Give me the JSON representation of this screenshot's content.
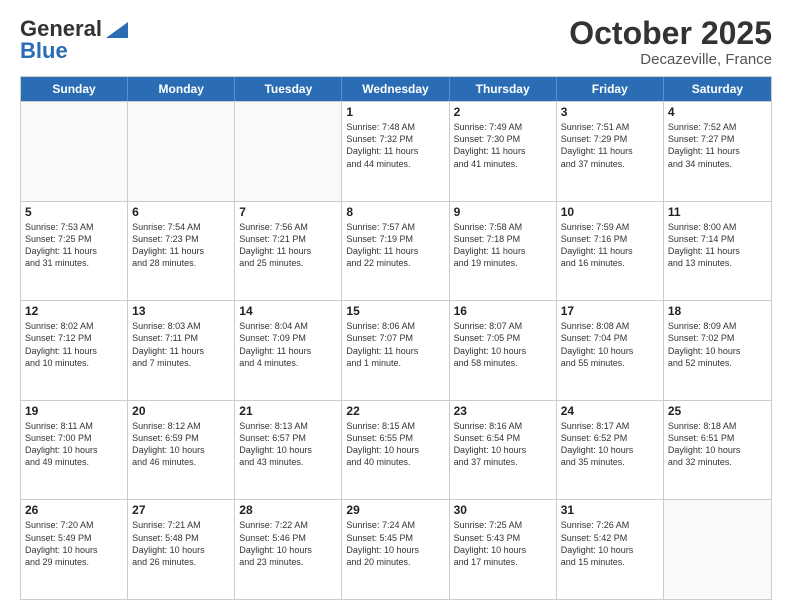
{
  "header": {
    "logo_line1": "General",
    "logo_line2": "Blue",
    "month": "October 2025",
    "location": "Decazeville, France"
  },
  "weekdays": [
    "Sunday",
    "Monday",
    "Tuesday",
    "Wednesday",
    "Thursday",
    "Friday",
    "Saturday"
  ],
  "weeks": [
    [
      {
        "day": "",
        "info": ""
      },
      {
        "day": "",
        "info": ""
      },
      {
        "day": "",
        "info": ""
      },
      {
        "day": "1",
        "info": "Sunrise: 7:48 AM\nSunset: 7:32 PM\nDaylight: 11 hours\nand 44 minutes."
      },
      {
        "day": "2",
        "info": "Sunrise: 7:49 AM\nSunset: 7:30 PM\nDaylight: 11 hours\nand 41 minutes."
      },
      {
        "day": "3",
        "info": "Sunrise: 7:51 AM\nSunset: 7:29 PM\nDaylight: 11 hours\nand 37 minutes."
      },
      {
        "day": "4",
        "info": "Sunrise: 7:52 AM\nSunset: 7:27 PM\nDaylight: 11 hours\nand 34 minutes."
      }
    ],
    [
      {
        "day": "5",
        "info": "Sunrise: 7:53 AM\nSunset: 7:25 PM\nDaylight: 11 hours\nand 31 minutes."
      },
      {
        "day": "6",
        "info": "Sunrise: 7:54 AM\nSunset: 7:23 PM\nDaylight: 11 hours\nand 28 minutes."
      },
      {
        "day": "7",
        "info": "Sunrise: 7:56 AM\nSunset: 7:21 PM\nDaylight: 11 hours\nand 25 minutes."
      },
      {
        "day": "8",
        "info": "Sunrise: 7:57 AM\nSunset: 7:19 PM\nDaylight: 11 hours\nand 22 minutes."
      },
      {
        "day": "9",
        "info": "Sunrise: 7:58 AM\nSunset: 7:18 PM\nDaylight: 11 hours\nand 19 minutes."
      },
      {
        "day": "10",
        "info": "Sunrise: 7:59 AM\nSunset: 7:16 PM\nDaylight: 11 hours\nand 16 minutes."
      },
      {
        "day": "11",
        "info": "Sunrise: 8:00 AM\nSunset: 7:14 PM\nDaylight: 11 hours\nand 13 minutes."
      }
    ],
    [
      {
        "day": "12",
        "info": "Sunrise: 8:02 AM\nSunset: 7:12 PM\nDaylight: 11 hours\nand 10 minutes."
      },
      {
        "day": "13",
        "info": "Sunrise: 8:03 AM\nSunset: 7:11 PM\nDaylight: 11 hours\nand 7 minutes."
      },
      {
        "day": "14",
        "info": "Sunrise: 8:04 AM\nSunset: 7:09 PM\nDaylight: 11 hours\nand 4 minutes."
      },
      {
        "day": "15",
        "info": "Sunrise: 8:06 AM\nSunset: 7:07 PM\nDaylight: 11 hours\nand 1 minute."
      },
      {
        "day": "16",
        "info": "Sunrise: 8:07 AM\nSunset: 7:05 PM\nDaylight: 10 hours\nand 58 minutes."
      },
      {
        "day": "17",
        "info": "Sunrise: 8:08 AM\nSunset: 7:04 PM\nDaylight: 10 hours\nand 55 minutes."
      },
      {
        "day": "18",
        "info": "Sunrise: 8:09 AM\nSunset: 7:02 PM\nDaylight: 10 hours\nand 52 minutes."
      }
    ],
    [
      {
        "day": "19",
        "info": "Sunrise: 8:11 AM\nSunset: 7:00 PM\nDaylight: 10 hours\nand 49 minutes."
      },
      {
        "day": "20",
        "info": "Sunrise: 8:12 AM\nSunset: 6:59 PM\nDaylight: 10 hours\nand 46 minutes."
      },
      {
        "day": "21",
        "info": "Sunrise: 8:13 AM\nSunset: 6:57 PM\nDaylight: 10 hours\nand 43 minutes."
      },
      {
        "day": "22",
        "info": "Sunrise: 8:15 AM\nSunset: 6:55 PM\nDaylight: 10 hours\nand 40 minutes."
      },
      {
        "day": "23",
        "info": "Sunrise: 8:16 AM\nSunset: 6:54 PM\nDaylight: 10 hours\nand 37 minutes."
      },
      {
        "day": "24",
        "info": "Sunrise: 8:17 AM\nSunset: 6:52 PM\nDaylight: 10 hours\nand 35 minutes."
      },
      {
        "day": "25",
        "info": "Sunrise: 8:18 AM\nSunset: 6:51 PM\nDaylight: 10 hours\nand 32 minutes."
      }
    ],
    [
      {
        "day": "26",
        "info": "Sunrise: 7:20 AM\nSunset: 5:49 PM\nDaylight: 10 hours\nand 29 minutes."
      },
      {
        "day": "27",
        "info": "Sunrise: 7:21 AM\nSunset: 5:48 PM\nDaylight: 10 hours\nand 26 minutes."
      },
      {
        "day": "28",
        "info": "Sunrise: 7:22 AM\nSunset: 5:46 PM\nDaylight: 10 hours\nand 23 minutes."
      },
      {
        "day": "29",
        "info": "Sunrise: 7:24 AM\nSunset: 5:45 PM\nDaylight: 10 hours\nand 20 minutes."
      },
      {
        "day": "30",
        "info": "Sunrise: 7:25 AM\nSunset: 5:43 PM\nDaylight: 10 hours\nand 17 minutes."
      },
      {
        "day": "31",
        "info": "Sunrise: 7:26 AM\nSunset: 5:42 PM\nDaylight: 10 hours\nand 15 minutes."
      },
      {
        "day": "",
        "info": ""
      }
    ]
  ]
}
